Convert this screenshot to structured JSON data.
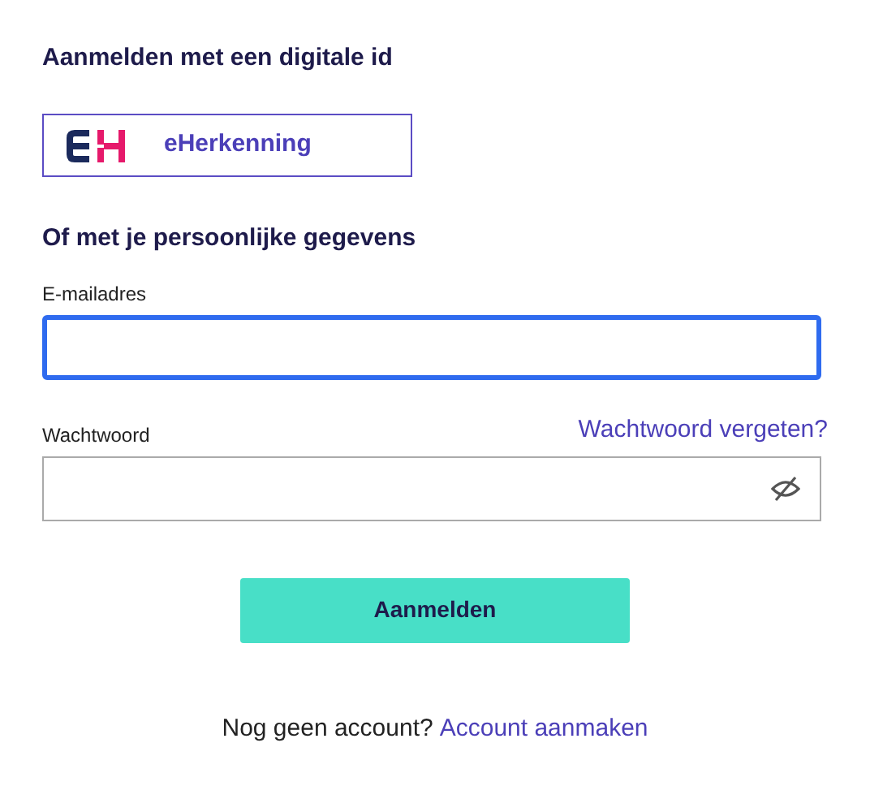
{
  "digital_id": {
    "heading": "Aanmelden met een digitale id",
    "provider_button": {
      "label": "eHerkenning"
    }
  },
  "personal": {
    "heading": "Of met je persoonlijke gegevens",
    "fields": [
      {
        "kind": "email",
        "label": "E-mailadres",
        "focused": true
      },
      {
        "kind": "password",
        "label": "Wachtwoord",
        "focused": false,
        "link": "Wachtwoord vergeten?"
      }
    ]
  },
  "submit_button": "Aanmelden",
  "footer": {
    "text": "Nog geen account?",
    "link": "Account aanmaken"
  }
}
